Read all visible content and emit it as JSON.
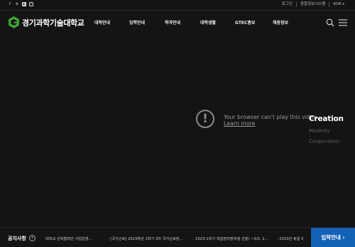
{
  "social": {
    "facebook": "f",
    "blog": "b",
    "youtube": "▶",
    "instagram": "◦"
  },
  "util": {
    "login": "로그인",
    "portal": "종합정보시스템",
    "lang": "KOR"
  },
  "header": {
    "logo_text": "경기과학기술대학교",
    "nav": [
      "대학안내",
      "입학안내",
      "학과안내",
      "대학생활",
      "GTEC홍보",
      "채용정보"
    ]
  },
  "video": {
    "error_message": "Your browser can't play this video.",
    "learn_more": "Learn more",
    "error_glyph": "!"
  },
  "slogans": [
    "Creation",
    "Modesty",
    "Cooperation"
  ],
  "notice": {
    "label": "공지사항",
    "more_glyph": "+",
    "items": [
      "대학교 산학협력단 사업운영...",
      "· [국가근로] 2023학년 1학기 3차 국가근로장...",
      "· 2023-1학기 학습장려장학생 선발( ~5/3, 2...",
      "· 2023년 휴일 0"
    ],
    "admission_button": "입학안내 ›"
  },
  "colors": {
    "background": "#141414",
    "logo_green": "#3aa935",
    "button_blue": "#1461b8"
  }
}
